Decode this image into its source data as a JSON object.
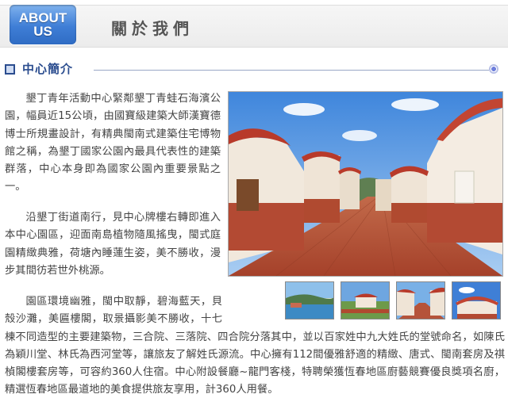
{
  "header": {
    "badge_line1": "ABOUT",
    "badge_line2": "US",
    "title": "關於我們"
  },
  "section": {
    "title": "中心簡介"
  },
  "content": {
    "paragraph1": "墾丁青年活動中心緊鄰墾丁青蛙石海濱公園，幅員近15公頃，由國寶級建築大師漢寶德博士所規畫設計，有精典閩南式建築住宅博物館之稱，為墾丁國家公園內最具代表性的建築群落，中心本身即為國家公園內重要景點之一。",
    "paragraph2": "沿墾丁街道南行，見中心牌樓右轉即進入本中心園區，迎面南島植物隨風搖曳，閩式庭園精緻典雅，荷塘內睡蓮生姿，美不勝收，漫步其間彷若世外桃源。",
    "paragraph3": "園區環境幽雅，閩中取靜，碧海藍天，貝殼沙灘，美匾樓閣，取景攝影美不勝收，十七棟不同造型的主要建築物，三合院、三落院、四合院分落其中，並以百家姓中九大姓氏的堂號命名，如陳氏為穎川堂、林氏為西河堂等，讓旅友了解姓氏源流。中心擁有112間優雅舒適的精緻、唐式、閩南套房及祺楨閣樓套房等，可容約360人住宿。中心附設餐廳~龍門客棧，特聘榮獲恆春地區廚藝競賽優良獎項名廚，精選恆春地區最道地的美食提供旅友享用，計360人用餐。"
  },
  "colors": {
    "badge_blue": "#3f7ed6",
    "section_title": "#2b4d8f",
    "body_text": "#444444"
  }
}
